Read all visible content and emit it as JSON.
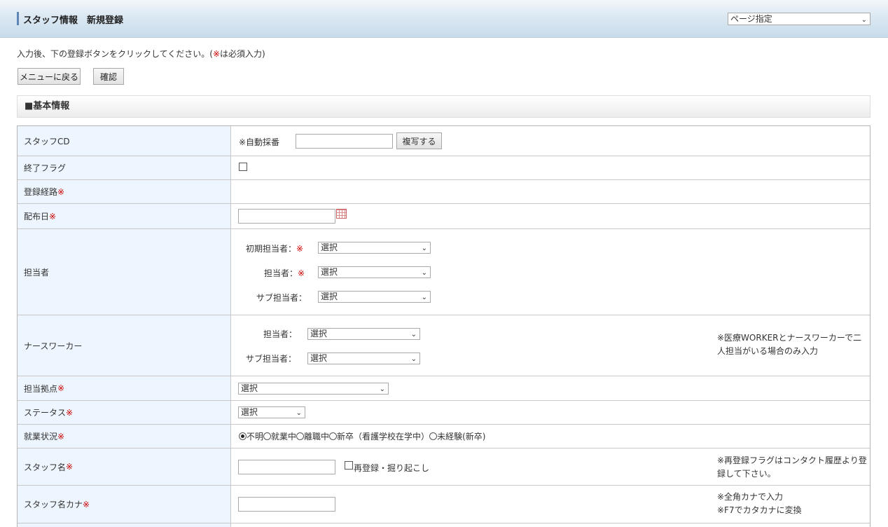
{
  "header": {
    "title": "スタッフ情報　新規登録",
    "page_select": "ページ指定"
  },
  "instruction": {
    "before": "入力後、下の登録ボタンをクリックしてください。(",
    "mark": "※",
    "after": "は必須入力)"
  },
  "buttons": {
    "menu_back": "メニューに戻る",
    "confirm": "確認"
  },
  "section_title": "■基本情報",
  "required_mark": "※",
  "rows": {
    "staff_cd": {
      "label": "スタッフCD",
      "auto_text": "※自動採番",
      "copy_button": "複写する",
      "value": ""
    },
    "end_flag": {
      "label": "終了フラグ",
      "checked": false
    },
    "route": {
      "label": "登録経路"
    },
    "delivery_date": {
      "label": "配布日",
      "value": ""
    },
    "tantosha": {
      "label": "担当者",
      "initial_label": "初期担当者：",
      "initial_value": "選択",
      "main_label": "担当者：",
      "main_value": "選択",
      "sub_label": "サブ担当者：",
      "sub_value": "選択"
    },
    "nurse_worker": {
      "label": "ナースワーカー",
      "main_label": "担当者：",
      "main_value": "選択",
      "sub_label": "サブ担当者：",
      "sub_value": "選択",
      "note_line1": "※医療WORKERとナースワーカーで二",
      "note_line2": "人担当がいる場合のみ入力"
    },
    "base": {
      "label": "担当拠点",
      "value": "選択"
    },
    "status": {
      "label": "ステータス",
      "value": "選択"
    },
    "employment": {
      "label": "就業状況",
      "options": [
        "不明",
        "就業中",
        "離職中",
        "新卒（看護学校在学中）",
        "未経験(新卒)"
      ],
      "selected": "不明"
    },
    "staff_name": {
      "label": "スタッフ名",
      "value": "",
      "reregister_label": "再登録・掘り起こし",
      "note_line1": "※再登録フラグはコンタクト履歴より登",
      "note_line2": "録して下さい。"
    },
    "staff_kana": {
      "label": "スタッフ名カナ",
      "value": "",
      "note_line1": "※全角カナで入力",
      "note_line2": "※F7でカタカナに変換"
    }
  },
  "icons": {
    "calendar": "calendar-icon",
    "dropdown": "chevron-down-icon"
  },
  "colors": {
    "required": "#cc0000",
    "label_bg": "#edf6fe",
    "header_accent": "#5d86b7"
  }
}
